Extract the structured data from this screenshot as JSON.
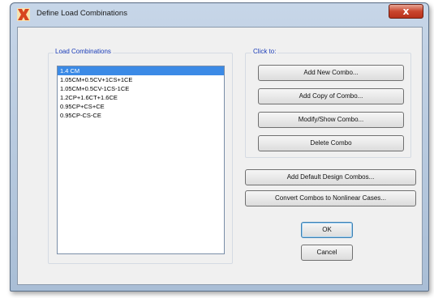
{
  "window": {
    "title": "Define Load Combinations",
    "close_label": "x"
  },
  "load_combinations": {
    "label": "Load Combinations",
    "items": [
      "1.4 CM",
      "1.05CM+0.5CV+1CS+1CE",
      "1.05CM+0.5CV-1CS-1CE",
      "1.2CP+1.6CT+1.6CE",
      "0.95CP+CS+CE",
      "0.95CP-CS-CE"
    ],
    "selected_index": 0
  },
  "click_to": {
    "label": "Click to:",
    "add_new": "Add New Combo...",
    "add_copy": "Add Copy of Combo...",
    "modify_show": "Modify/Show Combo...",
    "delete": "Delete Combo"
  },
  "actions": {
    "add_default": "Add Default Design Combos...",
    "convert": "Convert Combos to Nonlinear Cases...",
    "ok": "OK",
    "cancel": "Cancel"
  },
  "colors": {
    "selection": "#3b8ae6",
    "group_label": "#1a3cb8",
    "close_button": "#c9452d"
  }
}
